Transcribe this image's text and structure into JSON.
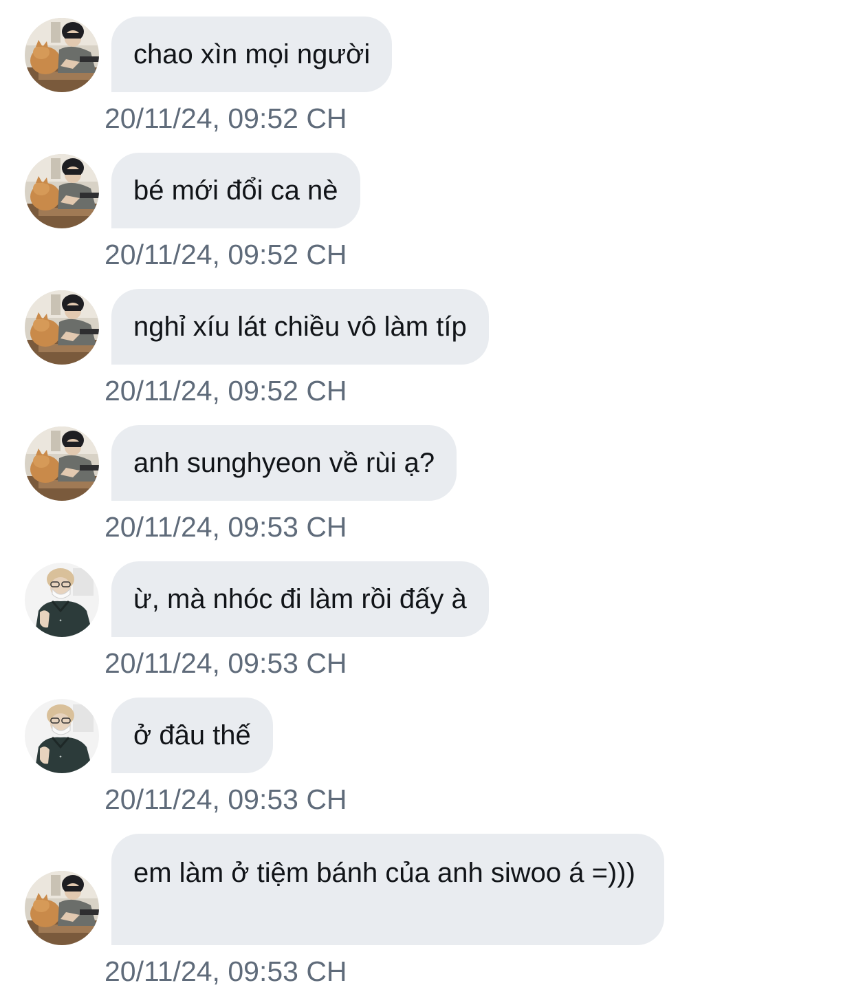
{
  "messages": [
    {
      "sender": "cat-boy",
      "text": "chao xìn mọi người",
      "time": "20/11/24, 09:52 CH"
    },
    {
      "sender": "cat-boy",
      "text": "bé mới đổi ca nè",
      "time": "20/11/24, 09:52 CH"
    },
    {
      "sender": "cat-boy",
      "text": "nghỉ xíu lát chiều vô làm típ",
      "time": "20/11/24, 09:52 CH"
    },
    {
      "sender": "cat-boy",
      "text": "anh sunghyeon về rùi ạ?",
      "time": "20/11/24, 09:53 CH"
    },
    {
      "sender": "masked-man",
      "text": "ừ, mà nhóc đi làm rồi đấy à",
      "time": "20/11/24, 09:53 CH"
    },
    {
      "sender": "masked-man",
      "text": "ở đâu thế",
      "time": "20/11/24, 09:53 CH"
    },
    {
      "sender": "cat-boy",
      "text": "em làm ở tiệm bánh của anh siwoo á =)))",
      "time": "20/11/24, 09:53 CH"
    }
  ],
  "colors": {
    "bubble": "#e9ecf0",
    "text": "#111418",
    "timestamp": "#5f6b7a",
    "background": "#ffffff"
  }
}
